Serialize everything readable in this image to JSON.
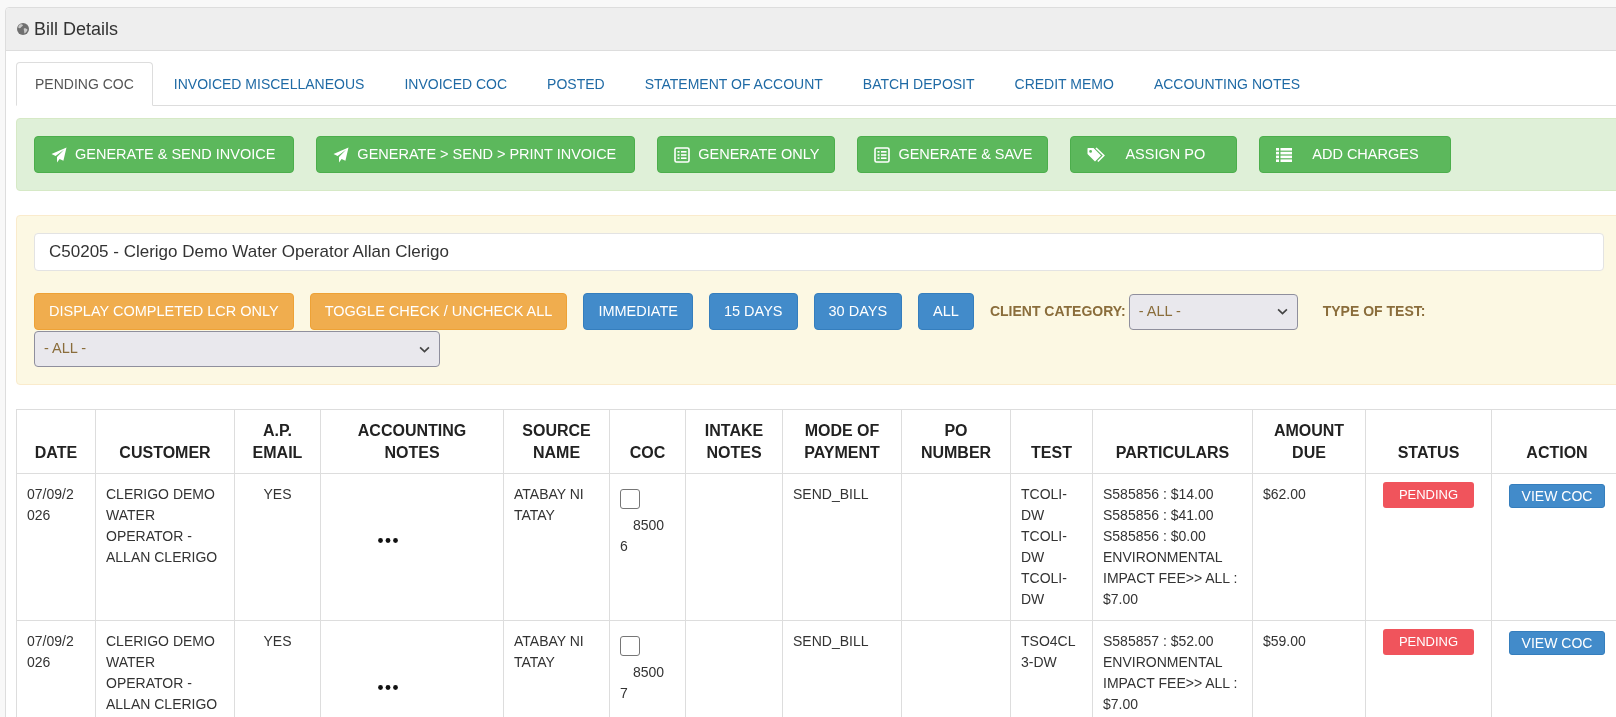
{
  "panel": {
    "title": "Bill Details"
  },
  "tabs": [
    {
      "label": "PENDING COC",
      "selected": true
    },
    {
      "label": "INVOICED MISCELLANEOUS",
      "selected": false
    },
    {
      "label": "INVOICED COC",
      "selected": false
    },
    {
      "label": "POSTED",
      "selected": false
    },
    {
      "label": "STATEMENT OF ACCOUNT",
      "selected": false
    },
    {
      "label": "BATCH DEPOSIT",
      "selected": false
    },
    {
      "label": "CREDIT MEMO",
      "selected": false
    },
    {
      "label": "ACCOUNTING NOTES",
      "selected": false
    }
  ],
  "action_buttons": [
    {
      "label": "GENERATE & SEND INVOICE",
      "kind": "send"
    },
    {
      "label": "GENERATE > SEND > PRINT INVOICE",
      "kind": "send"
    },
    {
      "label": "GENERATE ONLY",
      "kind": "generate"
    },
    {
      "label": "GENERATE & SAVE",
      "kind": "generate"
    },
    {
      "label": "ASSIGN PO",
      "kind": "assign"
    },
    {
      "label": "ADD CHARGES",
      "kind": "charges"
    }
  ],
  "filters": {
    "customer": {
      "value": "C50205 - Clerigo Demo Water Operator Allan Clerigo"
    },
    "buttons": [
      {
        "label": "DISPLAY COMPLETED LCR ONLY",
        "kind": "toggle"
      },
      {
        "label": "TOGGLE CHECK / UNCHECK ALL",
        "kind": "toggle"
      },
      {
        "label": "IMMEDIATE",
        "kind": "period"
      },
      {
        "label": "15 DAYS",
        "kind": "period"
      },
      {
        "label": "30 DAYS",
        "kind": "period"
      },
      {
        "label": "ALL",
        "kind": "period"
      }
    ],
    "selects": [
      {
        "label": "CLIENT CATEGORY:",
        "value": "- ALL -"
      },
      {
        "label": "TYPE OF TEST:",
        "value": "- ALL -"
      }
    ]
  },
  "table": {
    "columns": [
      "DATE",
      "CUSTOMER",
      "A.P. EMAIL",
      "ACCOUNTING NOTES",
      "SOURCE NAME",
      "COC",
      "INTAKE NOTES",
      "MODE OF PAYMENT",
      "PO NUMBER",
      "TEST",
      "PARTICULARS",
      "AMOUNT DUE",
      "STATUS",
      "ACTION"
    ],
    "rows": [
      {
        "date": "07/09/2026",
        "customer": "CLERIGO DEMO WATER OPERATOR - ALLAN CLERIGO",
        "ap_email": "YES",
        "source_name": "ATABAY NI TATAY",
        "coc": {
          "number": "85006",
          "checked": false
        },
        "mode_of_payment": "SEND_BILL",
        "test": [
          "TCOLI-DW",
          "TCOLI-DW",
          "TCOLI-DW"
        ],
        "particulars": [
          "S585856 : $14.00",
          "S585856 : $41.00",
          "S585856 : $0.00",
          "ENVIRONMENTAL IMPACT FEE>> ALL : $7.00"
        ],
        "amount_due": "$62.00",
        "status": "PENDING",
        "action": "VIEW COC"
      },
      {
        "date": "07/09/2026",
        "customer": "CLERIGO DEMO WATER OPERATOR - ALLAN CLERIGO",
        "ap_email": "YES",
        "source_name": "ATABAY NI TATAY",
        "coc": {
          "number": "85007",
          "checked": false
        },
        "mode_of_payment": "SEND_BILL",
        "test": [
          "TSO4CL3-DW"
        ],
        "particulars": [
          "S585857 : $52.00",
          "ENVIRONMENTAL IMPACT FEE>> ALL : $7.00"
        ],
        "amount_due": "$59.00",
        "status": "PENDING",
        "action": "VIEW COC"
      }
    ]
  }
}
